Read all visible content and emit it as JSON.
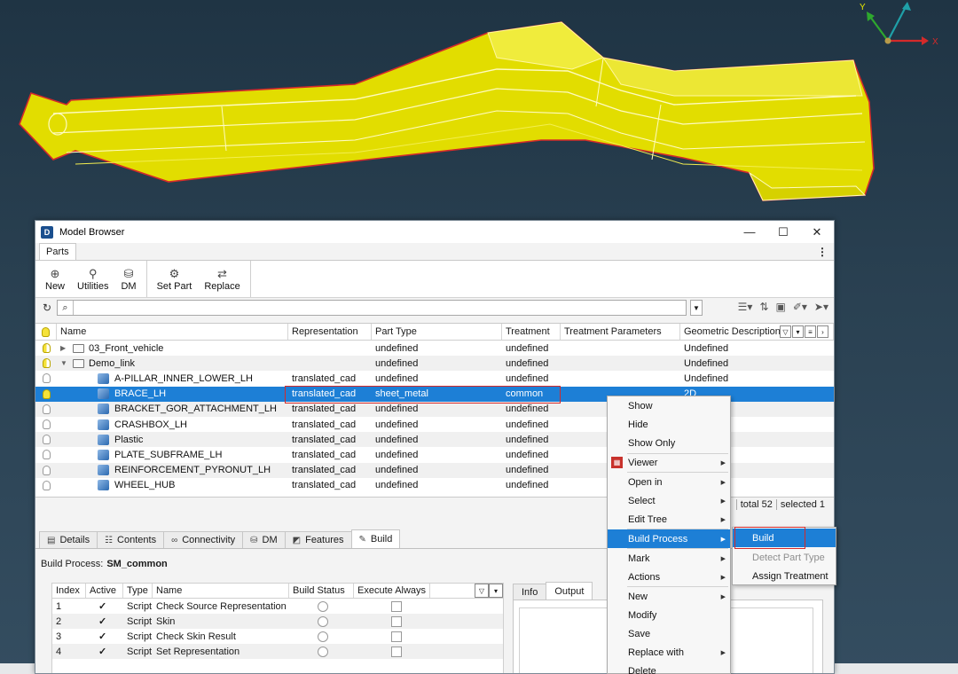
{
  "window": {
    "title": "Model Browser",
    "minimize": "—",
    "maximize": "☐",
    "close": "✕"
  },
  "parts_tab": "Parts",
  "toolbar": {
    "new": "New",
    "utilities": "Utilities",
    "dm": "DM",
    "set_part": "Set Part",
    "replace": "Replace"
  },
  "search": {
    "value": "",
    "placeholder": ""
  },
  "triad": {
    "y": "Y",
    "x": "X"
  },
  "columns": {
    "name": "Name",
    "representation": "Representation",
    "part_type": "Part Type",
    "treatment": "Treatment",
    "treatment_params": "Treatment Parameters",
    "geom_desc": "Geometric Description"
  },
  "rows": [
    {
      "name": "03_Front_vehicle",
      "rep": "",
      "pt": "undefined",
      "tr": "undefined",
      "gd": "Undefined"
    },
    {
      "name": "Demo_link",
      "rep": "",
      "pt": "undefined",
      "tr": "undefined",
      "gd": "Undefined"
    },
    {
      "name": "A-PILLAR_INNER_LOWER_LH",
      "rep": "translated_cad",
      "pt": "undefined",
      "tr": "undefined",
      "gd": "Undefined"
    },
    {
      "name": "BRACE_LH",
      "rep": "translated_cad",
      "pt": "sheet_metal",
      "tr": "common",
      "gd": "2D"
    },
    {
      "name": "BRACKET_GOR_ATTACHMENT_LH",
      "rep": "translated_cad",
      "pt": "undefined",
      "tr": "undefined",
      "gd": ""
    },
    {
      "name": "CRASHBOX_LH",
      "rep": "translated_cad",
      "pt": "undefined",
      "tr": "undefined",
      "gd": ""
    },
    {
      "name": "Plastic",
      "rep": "translated_cad",
      "pt": "undefined",
      "tr": "undefined",
      "gd": ""
    },
    {
      "name": "PLATE_SUBFRAME_LH",
      "rep": "translated_cad",
      "pt": "undefined",
      "tr": "undefined",
      "gd": ""
    },
    {
      "name": "REINFORCEMENT_PYRONUT_LH",
      "rep": "translated_cad",
      "pt": "undefined",
      "tr": "undefined",
      "gd": ""
    },
    {
      "name": "WHEEL_HUB",
      "rep": "translated_cad",
      "pt": "undefined",
      "tr": "undefined",
      "gd": ""
    }
  ],
  "totals": {
    "total": "total 52",
    "selected": "selected 1"
  },
  "bottom_tabs": [
    "Details",
    "Contents",
    "Connectivity",
    "DM",
    "Features",
    "Build"
  ],
  "build_process": {
    "label": "Build Process:",
    "value": "SM_common"
  },
  "steps_header": {
    "index": "Index",
    "active": "Active",
    "type": "Type",
    "name": "Name",
    "build_status": "Build Status",
    "execute_always": "Execute Always"
  },
  "steps": [
    {
      "index": "1",
      "active": "✓",
      "type": "Script",
      "name": "Check Source Representation"
    },
    {
      "index": "2",
      "active": "✓",
      "type": "Script",
      "name": "Skin"
    },
    {
      "index": "3",
      "active": "✓",
      "type": "Script",
      "name": "Check Skin Result"
    },
    {
      "index": "4",
      "active": "✓",
      "type": "Script",
      "name": "Set Representation"
    }
  ],
  "io_tabs": [
    "Info",
    "Output"
  ],
  "context_menu": [
    "Show",
    "Hide",
    "Show Only",
    "Viewer",
    "Open in",
    "Select",
    "Edit Tree",
    "Build Process",
    "Mark",
    "Actions",
    "New",
    "Modify",
    "Save",
    "Replace with",
    "Delete"
  ],
  "submenu": [
    "Build",
    "Detect Part Type",
    "Assign Treatment"
  ],
  "colors": {
    "selection": "#1d7fd6",
    "part_fill": "#e6e100",
    "outline": "#d42a2a"
  }
}
